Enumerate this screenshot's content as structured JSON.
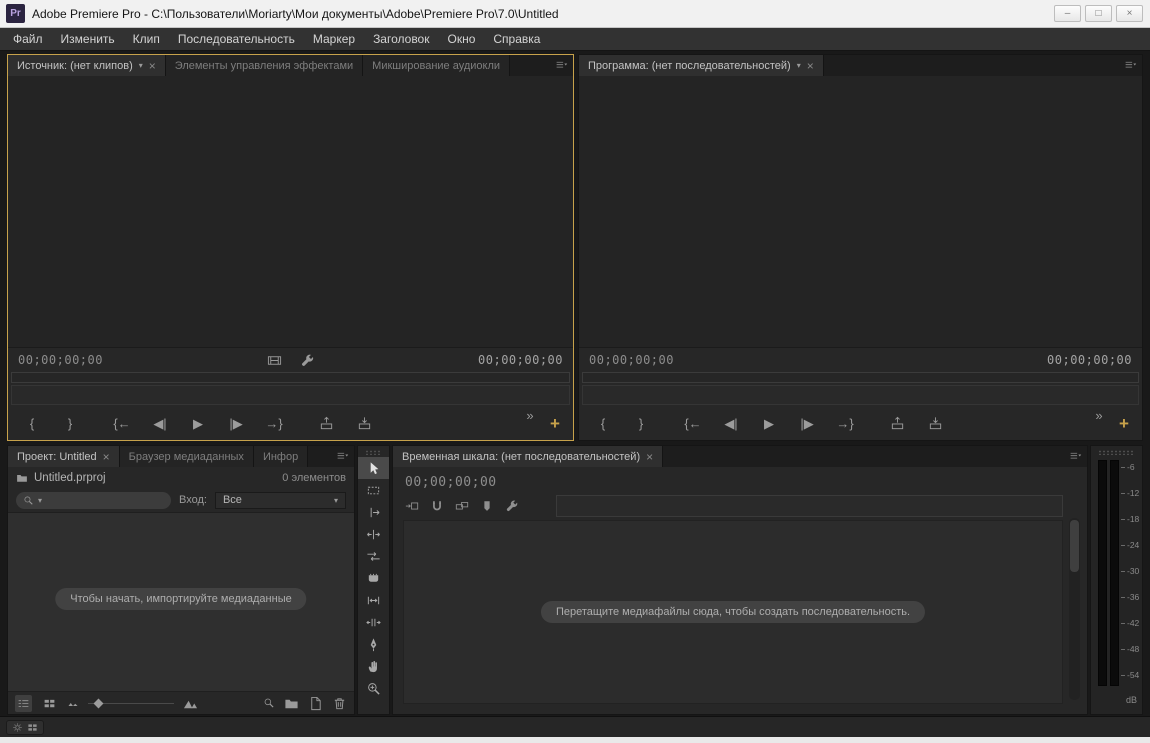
{
  "window": {
    "app_initials": "Pr",
    "title": "Adobe Premiere Pro - C:\\Пользователи\\Moriarty\\Мои документы\\Adobe\\Premiere Pro\\7.0\\Untitled",
    "controls": {
      "minimize": "–",
      "maximize": "□",
      "close": "×"
    }
  },
  "menu": {
    "items": [
      {
        "key": "file",
        "label": "Файл"
      },
      {
        "key": "edit",
        "label": "Изменить"
      },
      {
        "key": "clip",
        "label": "Клип"
      },
      {
        "key": "sequence",
        "label": "Последовательность"
      },
      {
        "key": "marker",
        "label": "Маркер"
      },
      {
        "key": "title",
        "label": "Заголовок"
      },
      {
        "key": "window",
        "label": "Окно"
      },
      {
        "key": "help",
        "label": "Справка"
      }
    ]
  },
  "source_panel": {
    "tabs": {
      "source": "Источник: (нет клипов)",
      "effect_controls": "Элементы управления эффектами",
      "audio_mixer": "Микширование аудиокли"
    },
    "timecode_left": "00;00;00;00",
    "timecode_right": "00;00;00;00"
  },
  "program_panel": {
    "tab": "Программа: (нет последовательностей)",
    "timecode_left": "00;00;00;00",
    "timecode_right": "00;00;00;00"
  },
  "transport": {
    "buttons": [
      {
        "name": "mark-in-button",
        "glyph": "{"
      },
      {
        "name": "mark-out-button",
        "glyph": "}"
      },
      {
        "name": "go-to-in-button",
        "glyph": "{←",
        "group": true
      },
      {
        "name": "step-back-button",
        "glyph": "◀|"
      },
      {
        "name": "play-button",
        "glyph": "▶"
      },
      {
        "name": "step-forward-button",
        "glyph": "|▶"
      },
      {
        "name": "go-to-out-button",
        "glyph": "→}"
      },
      {
        "name": "lift-button",
        "icon": "lift",
        "group": true
      },
      {
        "name": "extract-button",
        "icon": "extract"
      }
    ],
    "overflow": "»",
    "add": "+"
  },
  "project_panel": {
    "tabs": {
      "project": "Проект: Untitled",
      "media_browser": "Браузер медиаданных",
      "info": "Инфор"
    },
    "file_name": "Untitled.prproj",
    "items_count": "0 элементов",
    "search_value": "",
    "filter_label": "Вход:",
    "filter_value": "Все",
    "empty_message": "Чтобы начать, импортируйте медиаданные"
  },
  "tools": {
    "items": [
      {
        "name": "selection-tool",
        "icon": "arrow",
        "active": true
      },
      {
        "name": "track-select-tool",
        "icon": "track"
      },
      {
        "name": "ripple-edit-tool",
        "icon": "ripple"
      },
      {
        "name": "rolling-edit-tool",
        "icon": "rolling"
      },
      {
        "name": "rate-stretch-tool",
        "icon": "rate"
      },
      {
        "name": "razor-tool",
        "icon": "razor"
      },
      {
        "name": "slip-tool",
        "icon": "slip"
      },
      {
        "name": "slide-tool",
        "icon": "slide"
      },
      {
        "name": "pen-tool",
        "icon": "pen"
      },
      {
        "name": "hand-tool",
        "icon": "hand"
      },
      {
        "name": "zoom-tool",
        "icon": "zoom"
      }
    ]
  },
  "timeline_panel": {
    "tab": "Временная шкала: (нет последовательностей)",
    "timecode": "00;00;00;00",
    "toolbar": [
      {
        "name": "insert-nest-toggle",
        "icon": "nest"
      },
      {
        "name": "snap-toggle",
        "icon": "magnet"
      },
      {
        "name": "linked-selection-toggle",
        "icon": "linked"
      },
      {
        "name": "add-marker-button",
        "icon": "marker"
      },
      {
        "name": "timeline-settings-button",
        "icon": "wrench"
      }
    ],
    "empty_message": "Перетащите медиафайлы сюда, чтобы создать последовательность."
  },
  "audio_meter": {
    "labels": [
      "-6",
      "-12",
      "-18",
      "-24",
      "-30",
      "-36",
      "-42",
      "-48",
      "-54"
    ],
    "unit": "dB"
  },
  "colors": {
    "accent_gold": "#c7a24b",
    "titlebar_bg": "#f1f1f1",
    "panel_bg": "#272727"
  }
}
